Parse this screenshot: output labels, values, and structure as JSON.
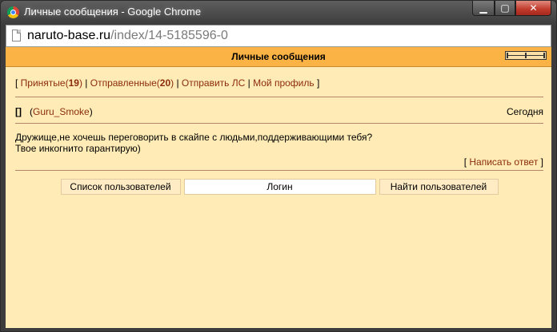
{
  "window": {
    "title": "Личные сообщения - Google Chrome",
    "controls": {
      "minimize": "▁",
      "maximize": "▢",
      "close": "✕"
    }
  },
  "address": {
    "domain": "naruto-base.ru",
    "path": "/index/14-5185596-0"
  },
  "page": {
    "header": "Личные сообщения",
    "nav": {
      "open": "[ ",
      "received_label": "Принятые",
      "received_count": "19",
      "sent_label": "Отправленные",
      "sent_count": "20",
      "send_label": "Отправить ЛС",
      "profile_label": "Мой профиль",
      "close": " ]"
    },
    "message": {
      "checkbox": "[]",
      "author": "Guru_Smoke",
      "date": "Сегодня",
      "line1": "Дружище,не хочешь переговорить в скайпе с людьми,поддерживающими тебя?",
      "line2": "Твое инкогнито гарантирую)",
      "reply_label": "Написать ответ"
    },
    "bottom": {
      "users_button": "Список пользователей",
      "login_value": "Логин",
      "find_button": "Найти пользователей"
    }
  },
  "colors": {
    "header_bg": "#fcb346",
    "content_bg": "#ffebb5",
    "link": "#8b2c0e"
  }
}
